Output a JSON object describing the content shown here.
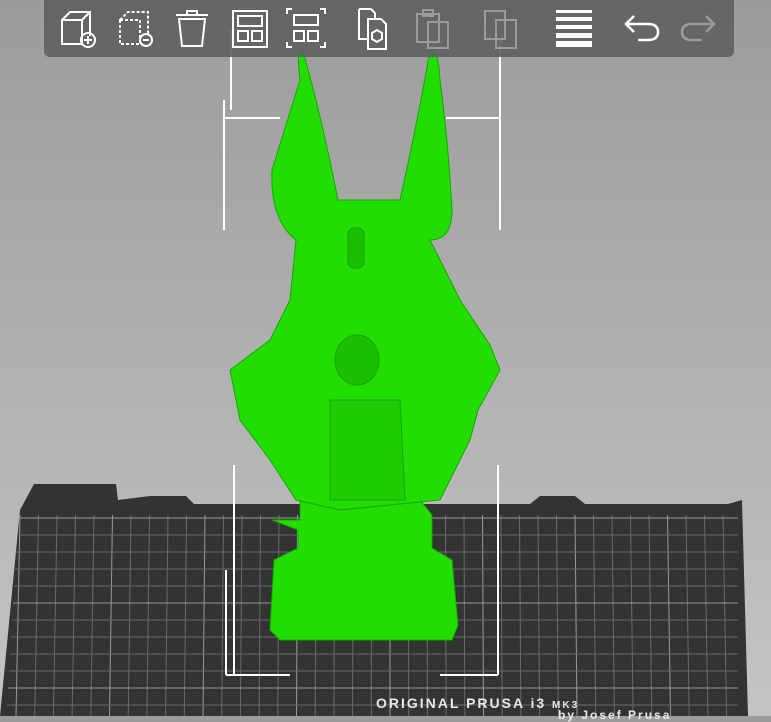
{
  "toolbar": {
    "buttons": [
      {
        "name": "add",
        "icon": "add-object-icon",
        "enabled": true
      },
      {
        "name": "delete",
        "icon": "delete-object-icon",
        "enabled": true
      },
      {
        "name": "delete-all",
        "icon": "trash-icon",
        "enabled": true
      },
      {
        "name": "arrange",
        "icon": "arrange-icon",
        "enabled": true
      },
      {
        "name": "arrange-selection",
        "icon": "arrange-selection-icon",
        "enabled": true
      },
      {
        "name": "copy",
        "icon": "copy-icon",
        "enabled": true
      },
      {
        "name": "paste",
        "icon": "paste-icon",
        "enabled": false
      },
      {
        "name": "instances",
        "icon": "instances-icon",
        "enabled": false
      },
      {
        "name": "layers",
        "icon": "layers-editing-icon",
        "enabled": true
      },
      {
        "name": "undo",
        "icon": "undo-icon",
        "enabled": true
      },
      {
        "name": "redo",
        "icon": "redo-icon",
        "enabled": false
      }
    ]
  },
  "bed": {
    "brand": "ORIGINAL PRUSA i3",
    "model": "MK3",
    "maker": "by Josef Prusa"
  },
  "colors": {
    "model": "#22dd00",
    "bed": "#3a3a3a",
    "toolbar": "#5f5f5f"
  }
}
